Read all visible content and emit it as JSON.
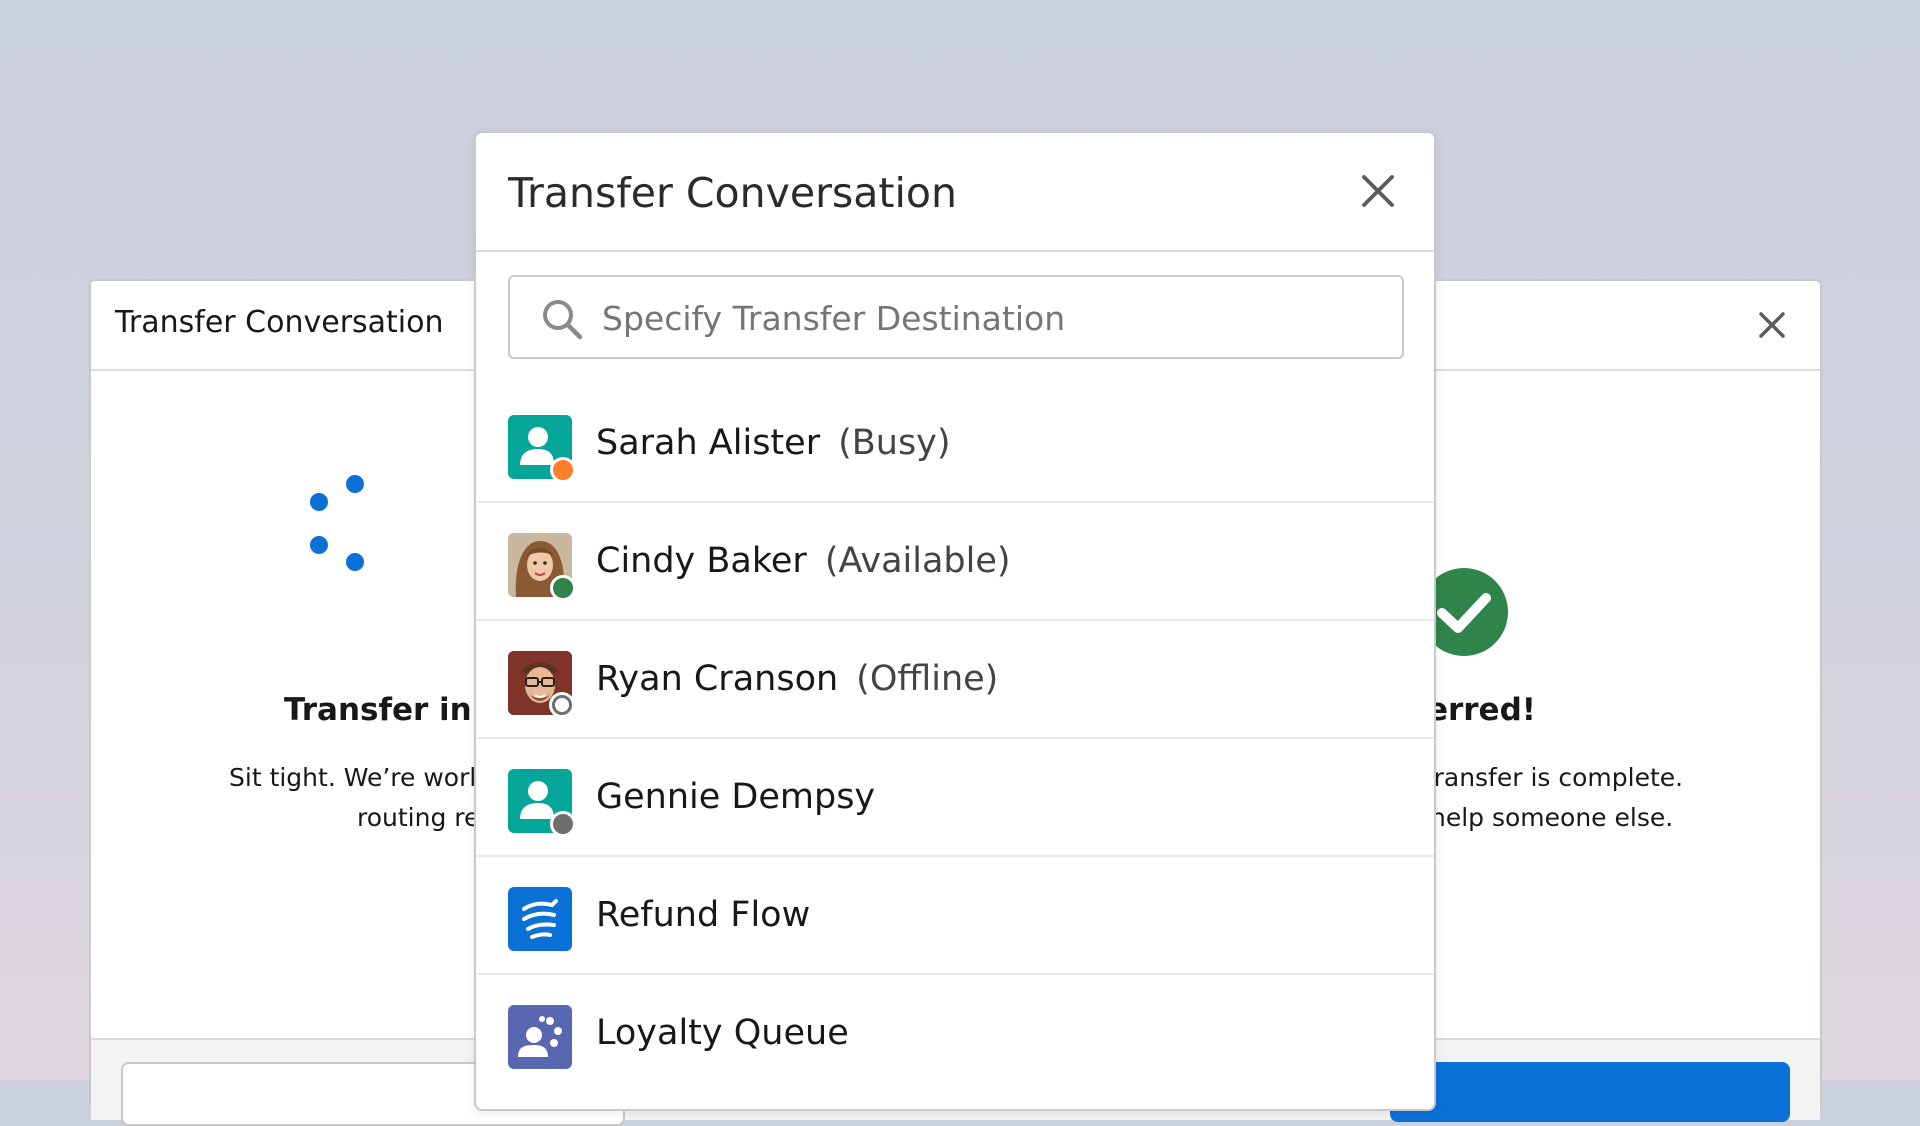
{
  "background_dialog": {
    "title": "Transfer Conversation",
    "in_progress": {
      "title": "Transfer in p",
      "line1": "Sit tight. We’re workir",
      "line2": "routing rec"
    },
    "completed": {
      "title": "sferred!",
      "line1": "n transfer is complete.",
      "line2": "help someone else."
    }
  },
  "modal": {
    "title": "Transfer Conversation",
    "search": {
      "placeholder": "Specify Transfer Destination",
      "value": ""
    },
    "items": [
      {
        "name": "Sarah Alister",
        "status": "(Busy)",
        "icon": "user-icon",
        "status_color": "#fe7e2e"
      },
      {
        "name": "Cindy Baker",
        "status": "(Available)",
        "icon": "photo-woman-avatar",
        "status_color": "#2e844a"
      },
      {
        "name": "Ryan Cranson",
        "status": "(Offline)",
        "icon": "photo-man-avatar",
        "status_color": "#ffffff"
      },
      {
        "name": "Gennie Dempsy",
        "status": "",
        "icon": "user-icon",
        "status_color": "#706e6b"
      },
      {
        "name": "Refund Flow",
        "status": "",
        "icon": "flow-icon",
        "status_color": ""
      },
      {
        "name": "Loyalty Queue",
        "status": "",
        "icon": "queue-icon",
        "status_color": ""
      }
    ]
  },
  "colors": {
    "brand_blue": "#0b71d6",
    "user_icon_teal": "#06a59a",
    "flow_blue": "#0b71d6",
    "queue_slate": "#5867b0",
    "success_green": "#2e844a",
    "busy_orange": "#fe7e2e",
    "offline_gray": "#706e6b"
  }
}
